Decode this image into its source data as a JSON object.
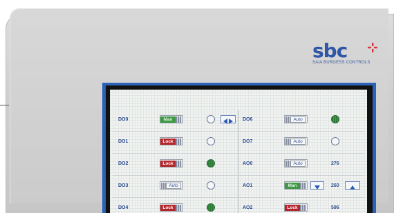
{
  "brand": {
    "logo_text": "sbc",
    "subtitle": "SAIA BURGESS CONTROLS",
    "colors": {
      "blue": "#2f57a6",
      "red": "#d1343a"
    }
  },
  "left_rows": [
    {
      "label": "DO0",
      "mode": "Man",
      "led": "off",
      "button": "left-right-arrows-icon"
    },
    {
      "label": "DO1",
      "mode": "Lock",
      "led": "off"
    },
    {
      "label": "DO2",
      "mode": "Lock",
      "led": "on"
    },
    {
      "label": "DO3",
      "mode": "Auto",
      "led": "off"
    },
    {
      "label": "DO4",
      "mode": "Lock",
      "led": "on"
    }
  ],
  "right_rows": [
    {
      "label": "DO6",
      "mode": "Auto",
      "led": "on"
    },
    {
      "label": "DO7",
      "mode": "Auto",
      "led": "off"
    },
    {
      "label": "AO0",
      "mode": "Auto",
      "value": "276"
    },
    {
      "label": "AO1",
      "mode": "Man",
      "value": "260",
      "buttons": [
        "down-arrow-icon",
        "up-arrow-icon"
      ]
    },
    {
      "label": "AO2",
      "mode": "Lock",
      "value": "596"
    }
  ],
  "colors": {
    "man": "#3c9a43",
    "lock": "#b5262a",
    "led_on": "#3fa049",
    "label_text": "#2f4e93"
  }
}
